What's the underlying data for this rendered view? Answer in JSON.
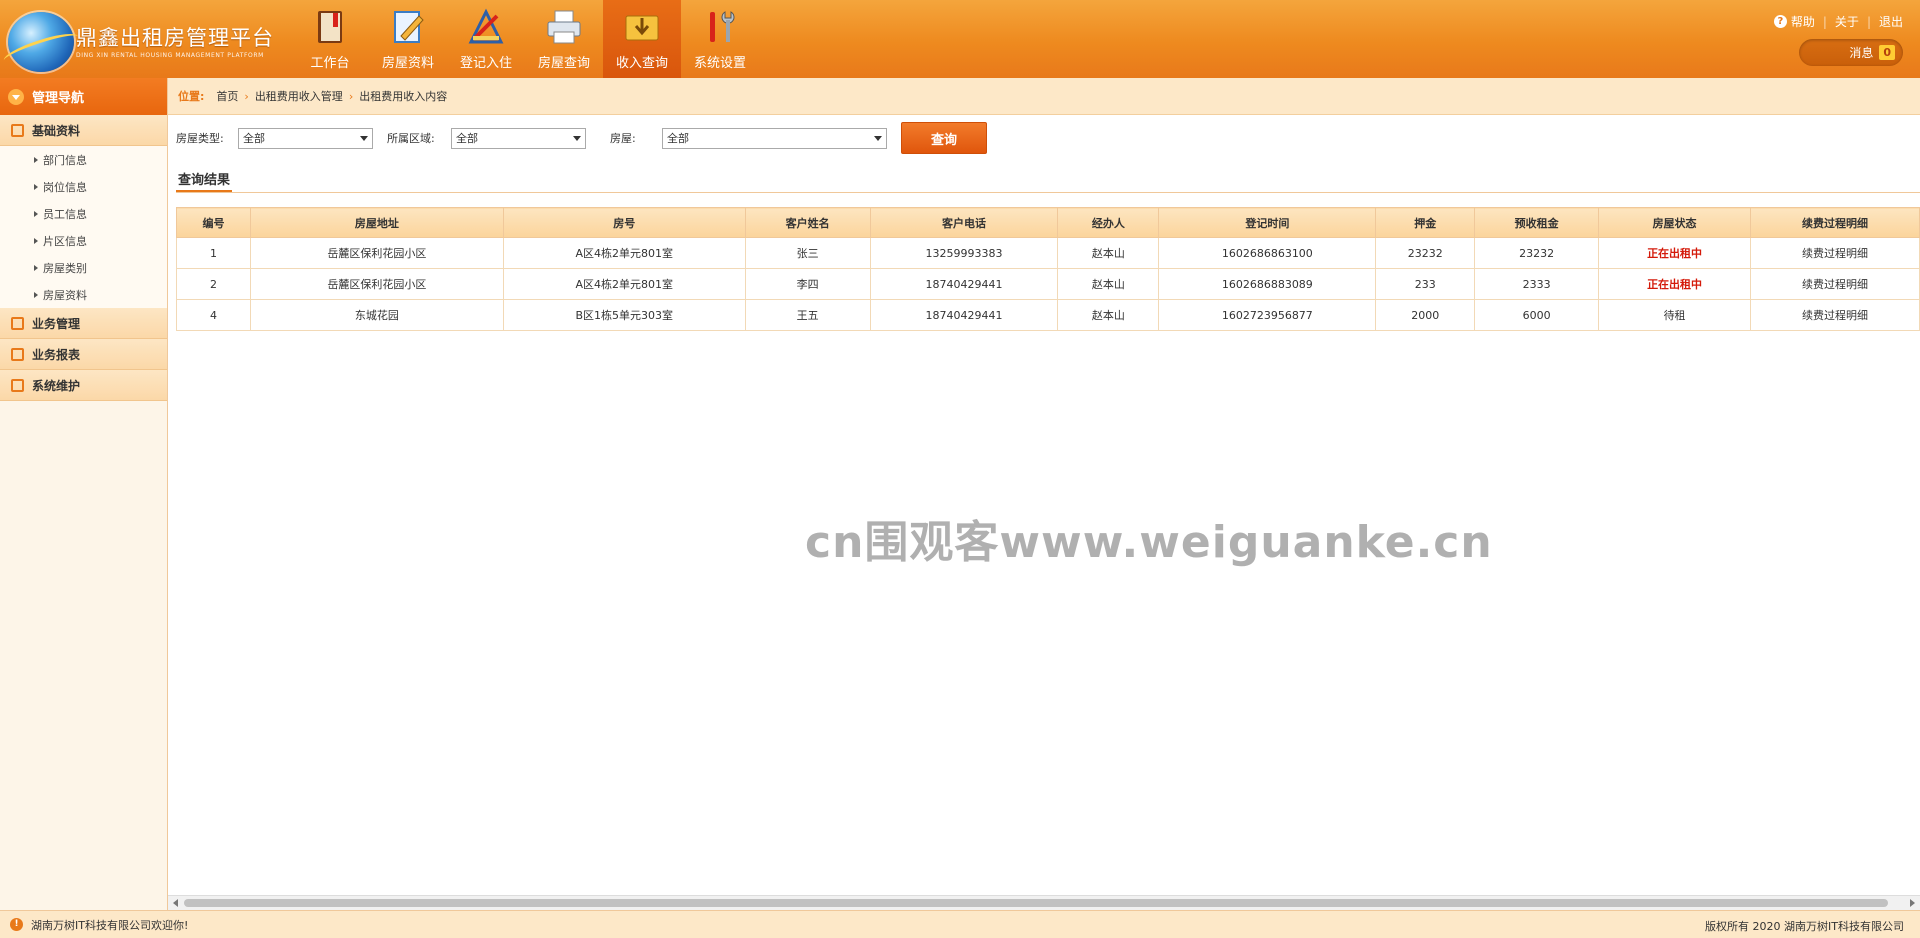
{
  "header": {
    "logo_title": "鼎鑫出租房管理平台",
    "logo_sub": "DING XIN RENTAL HOUSING MANAGEMENT PLATFORM",
    "nav": [
      {
        "label": "工作台",
        "icon": "book-icon"
      },
      {
        "label": "房屋资料",
        "icon": "edit-doc-icon"
      },
      {
        "label": "登记入住",
        "icon": "pen-ruler-icon"
      },
      {
        "label": "房屋查询",
        "icon": "printer-icon"
      },
      {
        "label": "收入查询",
        "icon": "download-folder-icon",
        "active": true
      },
      {
        "label": "系统设置",
        "icon": "tools-icon"
      }
    ],
    "links": {
      "help": "帮助",
      "about": "关于",
      "logout": "退出"
    },
    "message_label": "消息",
    "message_count": "0"
  },
  "sidebar": {
    "title": "管理导航",
    "groups": [
      {
        "label": "基础资料",
        "items": [
          "部门信息",
          "岗位信息",
          "员工信息",
          "片区信息",
          "房屋类别",
          "房屋资料"
        ]
      },
      {
        "label": "业务管理"
      },
      {
        "label": "业务报表"
      },
      {
        "label": "系统维护"
      }
    ]
  },
  "breadcrumb": {
    "prefix": "位置:",
    "items": [
      "首页",
      "出租费用收入管理",
      "出租费用收入内容"
    ]
  },
  "filters": {
    "house_type_label": "房屋类型:",
    "house_type_value": "全部",
    "area_label": "所属区域:",
    "area_value": "全部",
    "house_label": "房屋:",
    "house_value": "全部",
    "query_button": "查询"
  },
  "result_tab": "查询结果",
  "table": {
    "headers": [
      "编号",
      "房屋地址",
      "房号",
      "客户姓名",
      "客户电话",
      "经办人",
      "登记时间",
      "押金",
      "预收租金",
      "房屋状态",
      "续费过程明细"
    ],
    "rows": [
      [
        "1",
        "岳麓区保利花园小区",
        "A区4栋2单元801室",
        "张三",
        "13259993383",
        "赵本山",
        "1602686863100",
        "23232",
        "23232",
        "正在出租中",
        "续费过程明细"
      ],
      [
        "2",
        "岳麓区保利花园小区",
        "A区4栋2单元801室",
        "李四",
        "18740429441",
        "赵本山",
        "1602686883089",
        "233",
        "2333",
        "正在出租中",
        "续费过程明细"
      ],
      [
        "4",
        "东城花园",
        "B区1栋5单元303室",
        "王五",
        "18740429441",
        "赵本山",
        "1602723956877",
        "2000",
        "6000",
        "待租",
        "续费过程明细"
      ]
    ]
  },
  "watermark": "cn围观客www.weiguanke.cn",
  "footer": {
    "left": "湖南万树IT科技有限公司欢迎你!",
    "right": "版权所有 2020 湖南万树IT科技有限公司"
  },
  "colors": {
    "accent": "#e8791a",
    "danger": "#d41a0a"
  }
}
